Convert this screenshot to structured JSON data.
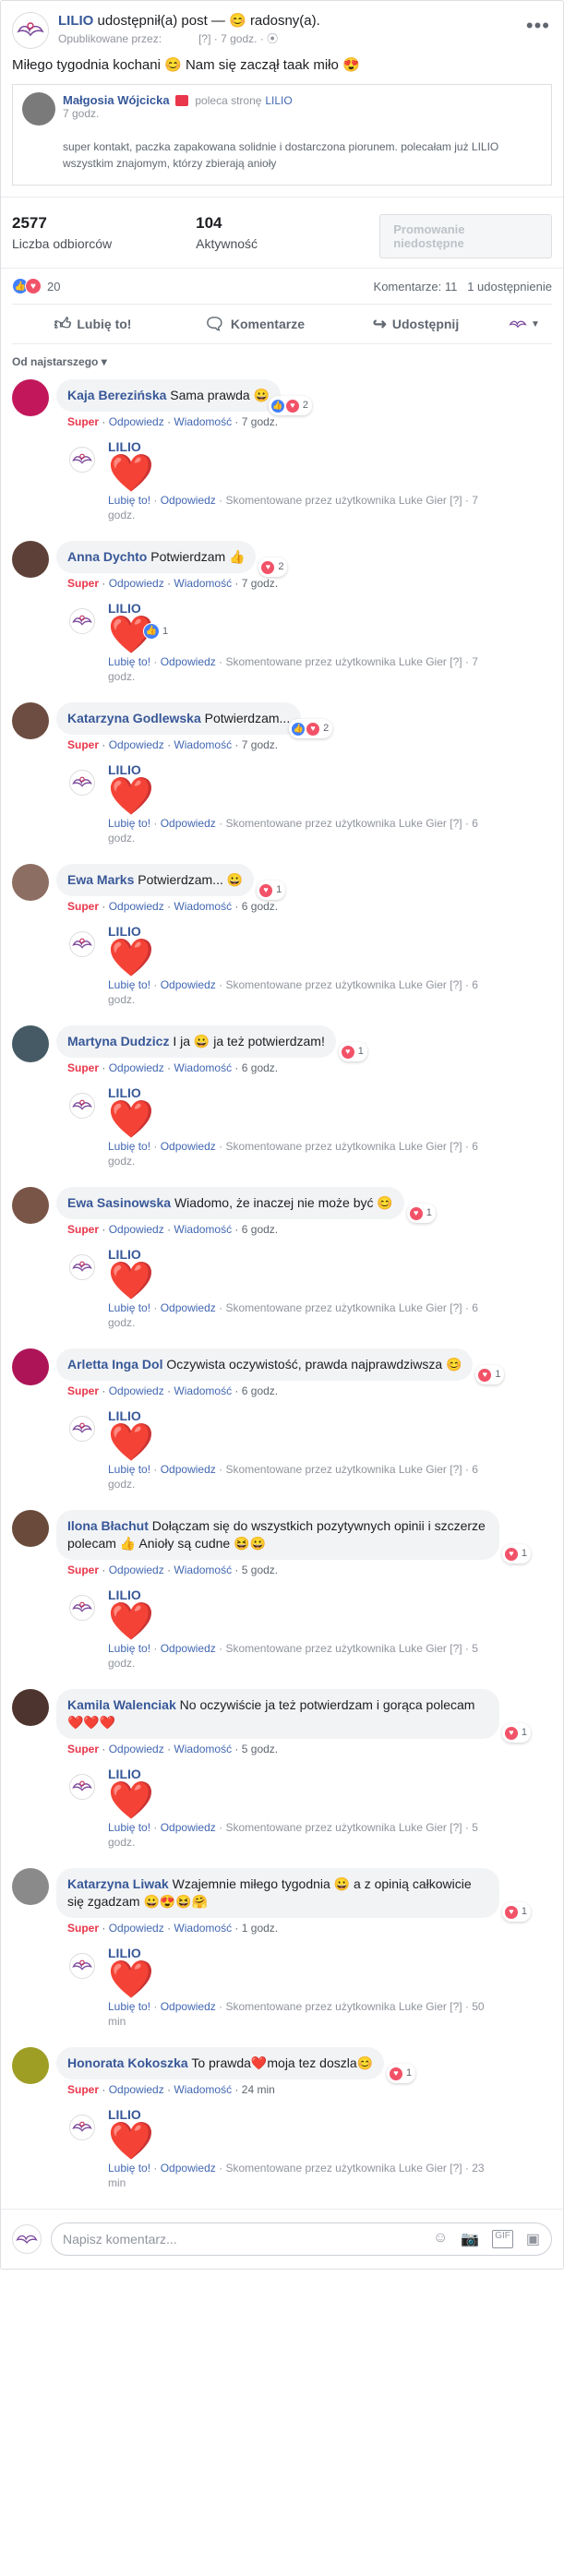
{
  "post": {
    "page_name": "LILIO",
    "shared_text": "udostępnił(a) post —",
    "feeling_emoji": "😊",
    "feeling_text": "radosny(a).",
    "published_by_label": "Opublikowane przez:",
    "published_by_placeholder": "[?]",
    "time": "7 godz.",
    "globe_icon": "⦿",
    "more_icon": "•••",
    "body_text": "Miłego tygodnia kochani 😊 Nam się zaczął taak miło 😍"
  },
  "recommendation": {
    "author": "Małgosia Wójcicka",
    "recommends_text": "poleca stronę",
    "page_link": "LILIO",
    "time": "7 godz.",
    "text": "super kontakt, paczka zapakowana solidnie i dostarczona piorunem. polecałam już LILIO wszystkim znajomym, którzy zbierają anioły"
  },
  "stats": {
    "reach_value": "2577",
    "reach_label": "Liczba odbiorców",
    "activity_value": "104",
    "activity_label": "Aktywność",
    "promo_label": "Promowanie niedostępne"
  },
  "reactions": {
    "count": "20",
    "comments_text": "Komentarze: 11",
    "shares_text": "1 udostępnienie"
  },
  "actions": {
    "like": "Lubię to!",
    "comment": "Komentarze",
    "share": "Udostępnij"
  },
  "sort_label": "Od najstarszego ▾",
  "comment_actions": {
    "super": "Super",
    "reply": "Odpowiedz",
    "message": "Wiadomość"
  },
  "reply_actions": {
    "like": "Lubię to!",
    "reply": "Odpowiedz",
    "commented_by": "Skomentowane przez użytkownika Luke Gier",
    "placeholder": "[?]"
  },
  "reply_author": "LILIO",
  "heart": "❤️",
  "comments": [
    {
      "author": "Kaja Berezińska",
      "text": "Sama prawda 😀",
      "time": "7 godz.",
      "react_count": "2",
      "react_like": true,
      "reply_time": "7 godz.",
      "reply_react": "",
      "avatar_color": "#c2185b"
    },
    {
      "author": "Anna Dychto",
      "text": "Potwierdzam 👍",
      "time": "7 godz.",
      "react_count": "2",
      "react_like": false,
      "reply_time": "7 godz.",
      "reply_react": "1",
      "avatar_color": "#5d4037"
    },
    {
      "author": "Katarzyna Godlewska",
      "text": "Potwierdzam...",
      "time": "7 godz.",
      "react_count": "2",
      "react_like": true,
      "reply_time": "6 godz.",
      "reply_react": "",
      "avatar_color": "#6d4c41"
    },
    {
      "author": "Ewa Marks",
      "text": "Potwierdzam... 😀",
      "time": "6 godz.",
      "react_count": "1",
      "react_like": false,
      "reply_time": "6 godz.",
      "reply_react": "",
      "avatar_color": "#8d6e63"
    },
    {
      "author": "Martyna Dudzicz",
      "text": "I ja 😀 ja też potwierdzam!",
      "time": "6 godz.",
      "react_count": "1",
      "react_like": false,
      "reply_time": "6 godz.",
      "reply_react": "",
      "avatar_color": "#455a64"
    },
    {
      "author": "Ewa Sasinowska",
      "text": "Wiadomo, że inaczej nie może być 😊",
      "time": "6 godz.",
      "react_count": "1",
      "react_like": false,
      "reply_time": "6 godz.",
      "reply_react": "",
      "avatar_color": "#795548"
    },
    {
      "author": "Arletta Inga Dol",
      "text": "Oczywista oczywistość, prawda najprawdziwsza 😊",
      "time": "6 godz.",
      "react_count": "1",
      "react_like": false,
      "reply_time": "6 godz.",
      "reply_react": "",
      "avatar_color": "#ad1457"
    },
    {
      "author": "Ilona Błachut",
      "text": "Dołączam się do wszystkich pozytywnych opinii i szczerze polecam 👍 Anioły są cudne 😆😀",
      "time": "5 godz.",
      "react_count": "1",
      "react_like": false,
      "reply_time": "5 godz.",
      "reply_react": "",
      "avatar_color": "#6a4a3a"
    },
    {
      "author": "Kamila Walenciak",
      "text": "No oczywiście ja też potwierdzam i gorąca polecam❤️❤️❤️",
      "time": "5 godz.",
      "react_count": "1",
      "react_like": false,
      "reply_time": "5 godz.",
      "reply_react": "",
      "avatar_color": "#4e342e"
    },
    {
      "author": "Katarzyna Liwak",
      "text": "Wzajemnie miłego tygodnia 😀 a z opinią całkowicie się zgadzam 😀😍😆🤗",
      "time": "1 godz.",
      "react_count": "1",
      "react_like": false,
      "reply_time": "50 min",
      "reply_react": "",
      "avatar_color": "#8a8a8a"
    },
    {
      "author": "Honorata Kokoszka",
      "text": "To prawda❤️moja tez doszla😊",
      "time": "24 min",
      "react_count": "1",
      "react_like": false,
      "reply_time": "23 min",
      "reply_react": "",
      "avatar_color": "#9e9d24"
    }
  ],
  "composer": {
    "placeholder": "Napisz komentarz...",
    "icons": [
      "☺",
      "📷",
      "GIF",
      "▣"
    ]
  }
}
